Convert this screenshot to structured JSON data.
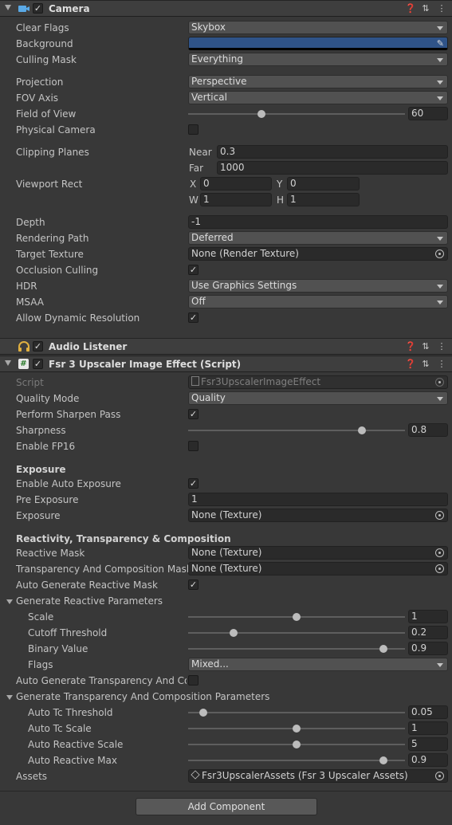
{
  "camera": {
    "title": "Camera",
    "clear_flags": {
      "label": "Clear Flags",
      "value": "Skybox"
    },
    "background": {
      "label": "Background",
      "color": "#2f5388"
    },
    "culling_mask": {
      "label": "Culling Mask",
      "value": "Everything"
    },
    "projection": {
      "label": "Projection",
      "value": "Perspective"
    },
    "fov_axis": {
      "label": "FOV Axis",
      "value": "Vertical"
    },
    "field_of_view": {
      "label": "Field of View",
      "value": "60",
      "fraction": 0.34
    },
    "physical_camera": {
      "label": "Physical Camera",
      "checked": false
    },
    "clipping": {
      "label": "Clipping Planes",
      "near_label": "Near",
      "near": "0.3",
      "far_label": "Far",
      "far": "1000"
    },
    "viewport": {
      "label": "Viewport Rect",
      "x_label": "X",
      "x": "0",
      "y_label": "Y",
      "y": "0",
      "w_label": "W",
      "w": "1",
      "h_label": "H",
      "h": "1"
    },
    "depth": {
      "label": "Depth",
      "value": "-1"
    },
    "rendering_path": {
      "label": "Rendering Path",
      "value": "Deferred"
    },
    "target_texture": {
      "label": "Target Texture",
      "value": "None (Render Texture)"
    },
    "occlusion": {
      "label": "Occlusion Culling",
      "checked": true
    },
    "hdr": {
      "label": "HDR",
      "value": "Use Graphics Settings"
    },
    "msaa": {
      "label": "MSAA",
      "value": "Off"
    },
    "dynamic_res": {
      "label": "Allow Dynamic Resolution",
      "checked": true
    }
  },
  "audio": {
    "title": "Audio Listener"
  },
  "fsr": {
    "title": "Fsr 3 Upscaler Image Effect (Script)",
    "script": {
      "label": "Script",
      "value": "Fsr3UpscalerImageEffect"
    },
    "quality_mode": {
      "label": "Quality Mode",
      "value": "Quality"
    },
    "sharpen": {
      "label": "Perform Sharpen Pass",
      "checked": true
    },
    "sharpness": {
      "label": "Sharpness",
      "value": "0.8",
      "fraction": 0.8
    },
    "fp16": {
      "label": "Enable FP16",
      "checked": false
    },
    "exposure_header": "Exposure",
    "auto_exposure": {
      "label": "Enable Auto Exposure",
      "checked": true
    },
    "pre_exposure": {
      "label": "Pre Exposure",
      "value": "1"
    },
    "exposure": {
      "label": "Exposure",
      "value": "None (Texture)"
    },
    "reactivity_header": "Reactivity, Transparency & Composition",
    "reactive_mask": {
      "label": "Reactive Mask",
      "value": "None (Texture)"
    },
    "tc_mask": {
      "label": "Transparency And Composition Mask",
      "value": "None (Texture)"
    },
    "auto_reactive": {
      "label": "Auto Generate Reactive Mask",
      "checked": true
    },
    "gen_reactive": {
      "label": "Generate Reactive Parameters",
      "scale": {
        "label": "Scale",
        "value": "1",
        "fraction": 0.5
      },
      "cutoff": {
        "label": "Cutoff Threshold",
        "value": "0.2",
        "fraction": 0.21
      },
      "binary": {
        "label": "Binary Value",
        "value": "0.9",
        "fraction": 0.9
      },
      "flags": {
        "label": "Flags",
        "value": "Mixed..."
      }
    },
    "auto_tc": {
      "label": "Auto Generate Transparency And Com",
      "checked": false
    },
    "gen_tc": {
      "label": "Generate Transparency And Composition Parameters",
      "tc_threshold": {
        "label": "Auto Tc Threshold",
        "value": "0.05",
        "fraction": 0.07
      },
      "tc_scale": {
        "label": "Auto Tc Scale",
        "value": "1",
        "fraction": 0.5
      },
      "reactive_scale": {
        "label": "Auto Reactive Scale",
        "value": "5",
        "fraction": 0.5
      },
      "reactive_max": {
        "label": "Auto Reactive Max",
        "value": "0.9",
        "fraction": 0.9
      }
    },
    "assets": {
      "label": "Assets",
      "value": "Fsr3UpscalerAssets (Fsr 3 Upscaler Assets)"
    }
  },
  "add_component": "Add Component"
}
